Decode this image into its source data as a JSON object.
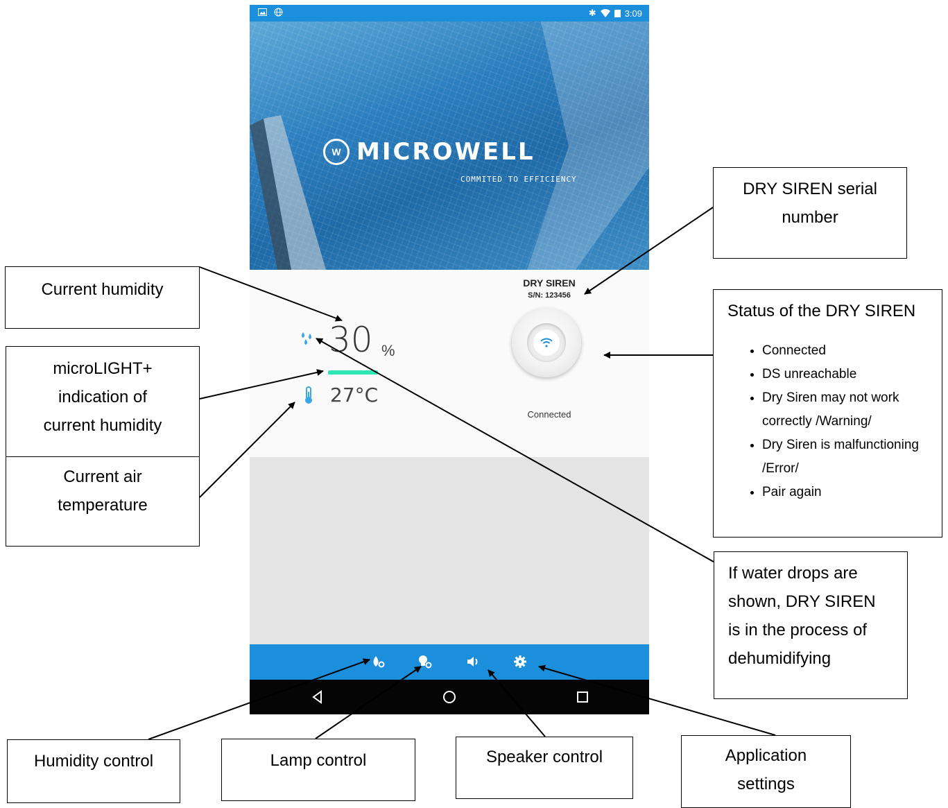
{
  "statusbar": {
    "time": "3:09"
  },
  "hero": {
    "brand": "MICROWELL",
    "tagline": "COMMITED TO EFFICIENCY"
  },
  "reading": {
    "humidity": "30",
    "humidity_unit": "%",
    "temperature": "27°C",
    "dehumidifying": true
  },
  "device": {
    "name": "DRY SIREN",
    "serial": "S/N: 123456",
    "status": "Connected"
  },
  "tabs": [
    {
      "name": "humidity-control",
      "icon": "droplet-gear-icon"
    },
    {
      "name": "lamp-control",
      "icon": "bulb-gear-icon"
    },
    {
      "name": "speaker-control",
      "icon": "speaker-icon"
    },
    {
      "name": "settings",
      "icon": "gear-icon"
    }
  ],
  "nav": {
    "back": "back-icon",
    "home": "home-icon",
    "recents": "recents-icon"
  },
  "annotations": {
    "current_humidity": "Current humidity",
    "microlight": [
      "microLIGHT+",
      "indication of",
      "current humidity"
    ],
    "air_temp": [
      "Current air",
      "temperature"
    ],
    "serial": [
      "DRY SIREN serial",
      "number"
    ],
    "status_title": "Status of the DRY SIREN",
    "status_items": [
      "Connected",
      "DS unreachable",
      "Dry Siren may not work correctly /Warning/",
      "Dry Siren is malfunctioning /Error/",
      "Pair again"
    ],
    "water_drops": [
      "If water drops are",
      "shown, DRY SIREN",
      "is in the process of",
      "dehumidifying"
    ],
    "humidity_control": "Humidity control",
    "lamp_control": "Lamp control",
    "speaker_control": "Speaker control",
    "app_settings": [
      "Application",
      "settings"
    ]
  }
}
